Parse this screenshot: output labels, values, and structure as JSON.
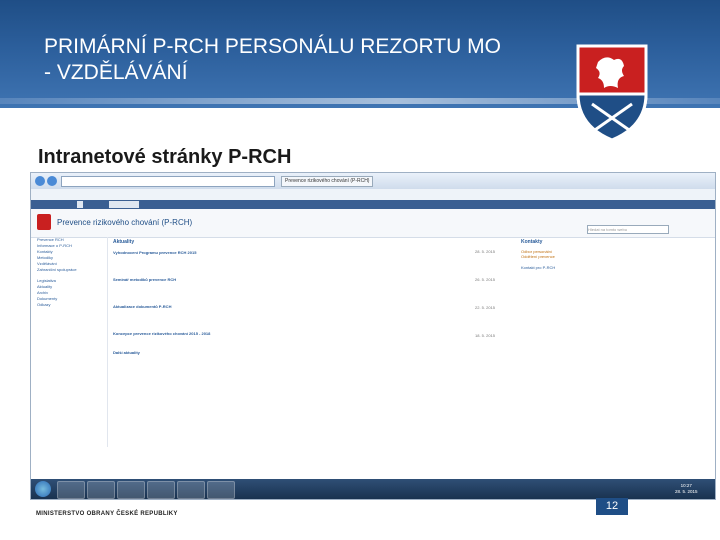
{
  "slide": {
    "title_line1": "PRIMÁRNÍ P-RCH PERSONÁLU REZORTU MO",
    "title_line2": "- VZDĚLÁVÁNÍ",
    "subtitle": "Intranetové stránky P-RCH",
    "page_number": "12",
    "footer": "MINISTERSTVO OBRANY ČESKÉ REPUBLIKY"
  },
  "colors": {
    "header": "#2c5f9c",
    "accent": "#1f4e86",
    "emblem_red": "#c92020"
  },
  "screenshot": {
    "banner_title": "Prevence rizikového chování (P-RCH)",
    "search_placeholder": "Hledat na tomto webu",
    "sidebar": [
      "Prevence RCH",
      "Informace o P-RCH",
      "Kontakty",
      "Metodiky",
      "Vzdělávání",
      "Zahraniční spolupráce",
      "Legislativa",
      "Aktuality",
      "Archiv",
      "Dokumenty",
      "Odkazy"
    ],
    "news_heading": "Aktuality",
    "news": [
      {
        "title": "Vyhodnocení Programu prevence RCH 2015",
        "date": "28. 5. 2015"
      },
      {
        "title": "Seminář metodiků prevence RCH",
        "date": "26. 5. 2015"
      },
      {
        "title": "Aktualizace dokumentů P-RCH",
        "date": "22. 5. 2015"
      },
      {
        "title": "Koncepce prevence rizikového chování 2015 - 2018",
        "date": "18. 5. 2015"
      }
    ],
    "more_news": "Další aktuality",
    "contacts_heading": "Kontakty",
    "contacts": [
      "Odbor personální",
      "Oddělení prevence",
      "Kontakt pro P-RCH"
    ],
    "clock_time": "10:27",
    "clock_date": "28. 5. 2015"
  }
}
